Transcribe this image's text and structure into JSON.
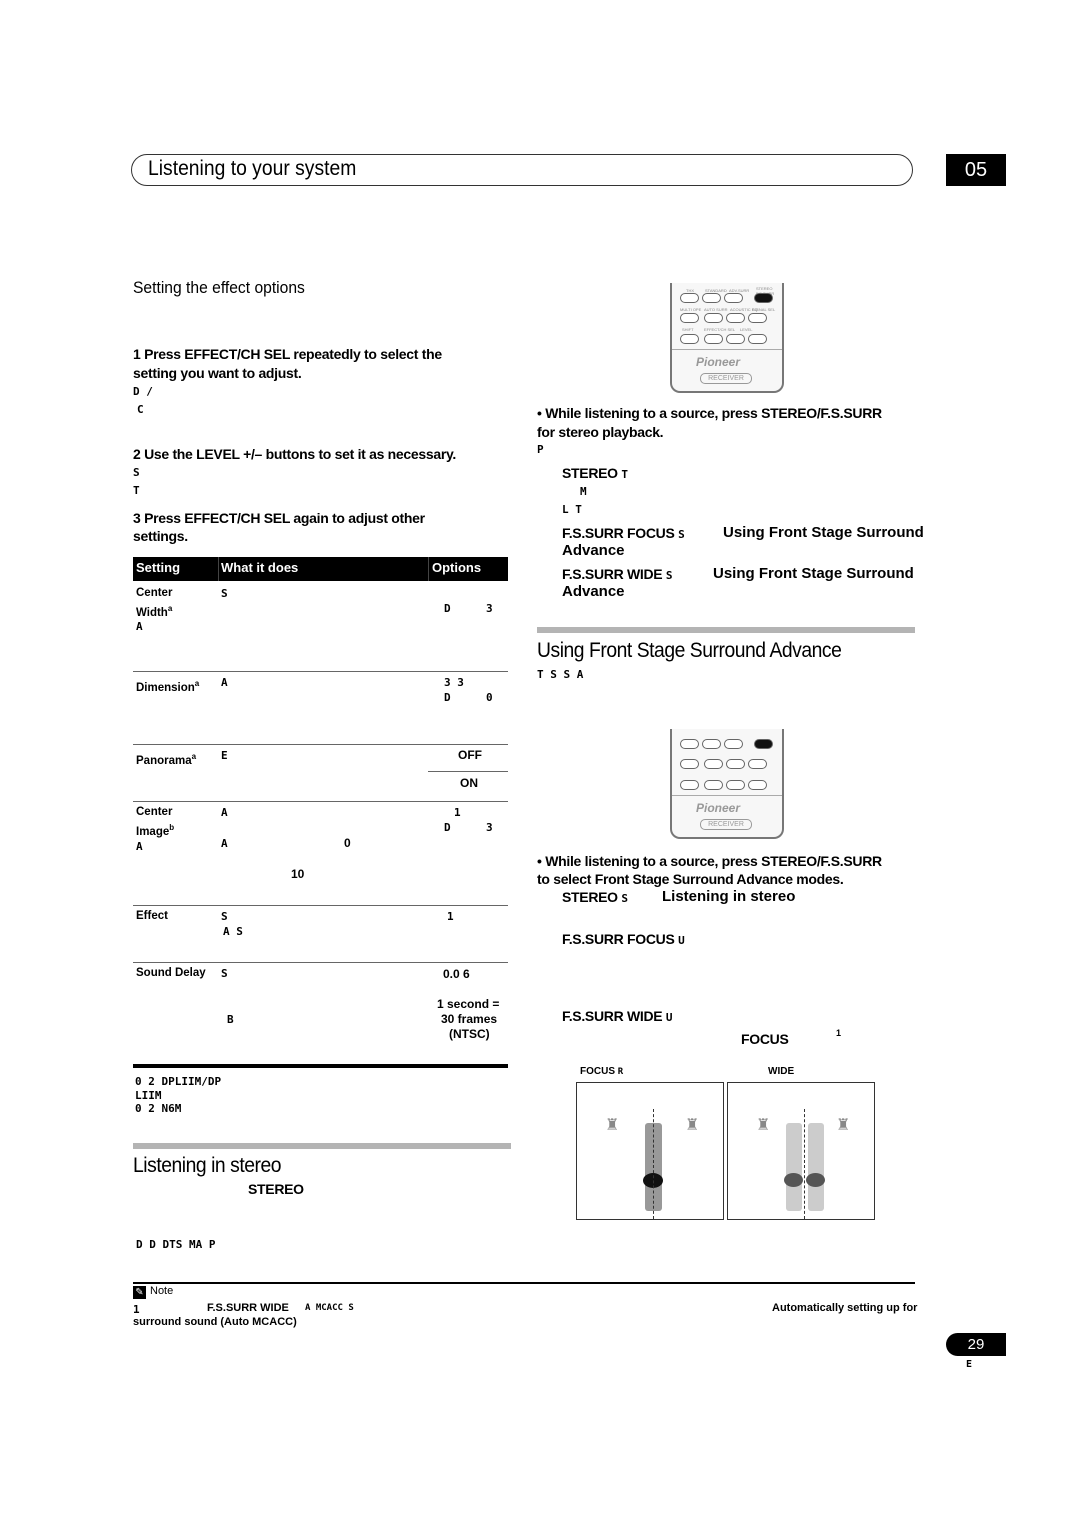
{
  "header": {
    "title": "Listening to your system",
    "chapter": "05"
  },
  "left": {
    "subheading": "Setting the effect options",
    "step1": "1    Press EFFECT/CH SEL repeatedly to select the",
    "step1b": "setting you want to adjust.",
    "s1f1": "D  /",
    "s1f2": "C",
    "step2": "2    Use the LEVEL +/– buttons to set it as necessary.",
    "s2f1": "S",
    "s2f2": "T",
    "step3": "3    Press EFFECT/CH SEL again to adjust other",
    "step3b": "settings.",
    "table": {
      "headers": [
        "Setting",
        "What it does",
        "Options"
      ],
      "r1": {
        "setting": "Center",
        "setting2": "Width",
        "sup": "a",
        "f1": "S",
        "f2": "A",
        "o1": "D",
        "o2": "3"
      },
      "r2": {
        "setting": "Dimension",
        "sup": "a",
        "f1": "A",
        "o1": "3 3",
        "o2": "D",
        "o3": "0"
      },
      "r3": {
        "setting": "Panorama",
        "sup": "a",
        "f1": "E",
        "o1": "OFF",
        "o2": "ON"
      },
      "r4": {
        "setting": "Center",
        "setting2": "Image",
        "sup": "b",
        "f1": "A",
        "f2": "A",
        "f3": "A",
        "f4": "0",
        "f5": "10",
        "o1": "1",
        "o2": "D",
        "o3": "3"
      },
      "r5": {
        "setting": "Effect",
        "f1": "S",
        "f2": "A S",
        "o1": "1"
      },
      "r6": {
        "setting": "Sound Delay",
        "f1": "S",
        "f2": "B",
        "o1": "0.0 6",
        "o2": "1 second =",
        "o3": "30 frames",
        "o4": "(NTSC)"
      }
    },
    "footnotes": [
      "0 2  DPLIIM/DP",
      "LIIM",
      "0 2  N6M"
    ],
    "stereo_heading": "Listening in stereo",
    "stereo_word": "STEREO",
    "stereo_frag": "D D DTS  MA P"
  },
  "right": {
    "remote": {
      "brand": "Pioneer",
      "label": "RECEIVER",
      "buttons": [
        "THX",
        "STANDARD",
        "ADV.SURR",
        "STEREO F.S.SURR",
        "MULTI OPE",
        "AUTO SURR",
        "ACOUSTIC EQ",
        "SIGNAL SEL",
        "SHIFT",
        "EFFECT/CH SEL",
        "LEVEL",
        "–",
        "+"
      ]
    },
    "bullet1": "•    While listening to a source, press STEREO/F.S.SURR",
    "bullet1b": "for stereo playback.",
    "p": "P",
    "items": [
      {
        "name": "STEREO",
        "f": "T"
      },
      {
        "f": "M"
      },
      {
        "f": "L T"
      },
      {
        "name": "F.S.SURR FOCUS",
        "f": "S",
        "ref": "Using Front Stage Surround",
        "ref2": "Advance"
      },
      {
        "name": "F.S.SURR WIDE",
        "f": "S",
        "ref": "Using Front Stage Surround",
        "ref2": "Advance"
      }
    ],
    "fss_heading": "Using Front Stage Surround Advance",
    "fss_frag": "T S S A",
    "bullet2": "•    While listening to a source, press STEREO/F.S.SURR",
    "bullet2b": "to select Front Stage Surround Advance modes.",
    "m1": "STEREO",
    "m1f": "S",
    "m1ref": "Listening in stereo",
    "m2": "F.S.SURR FOCUS",
    "m2f": "U",
    "m3": "F.S.SURR WIDE",
    "m3f": "U",
    "focus_word": "FOCUS",
    "focus_sup": "1",
    "diag_focus": "FOCUS",
    "diag_focus_f": "R",
    "diag_wide": "WIDE"
  },
  "note": {
    "label": "Note",
    "line1a": "1",
    "line1b": "F.S.SURR WIDE",
    "line1c": "A MCACC S",
    "ref": "Automatically setting up for",
    "ref2": "surround sound (Auto MCACC)"
  },
  "footer": {
    "page": "29",
    "lang": "E"
  }
}
